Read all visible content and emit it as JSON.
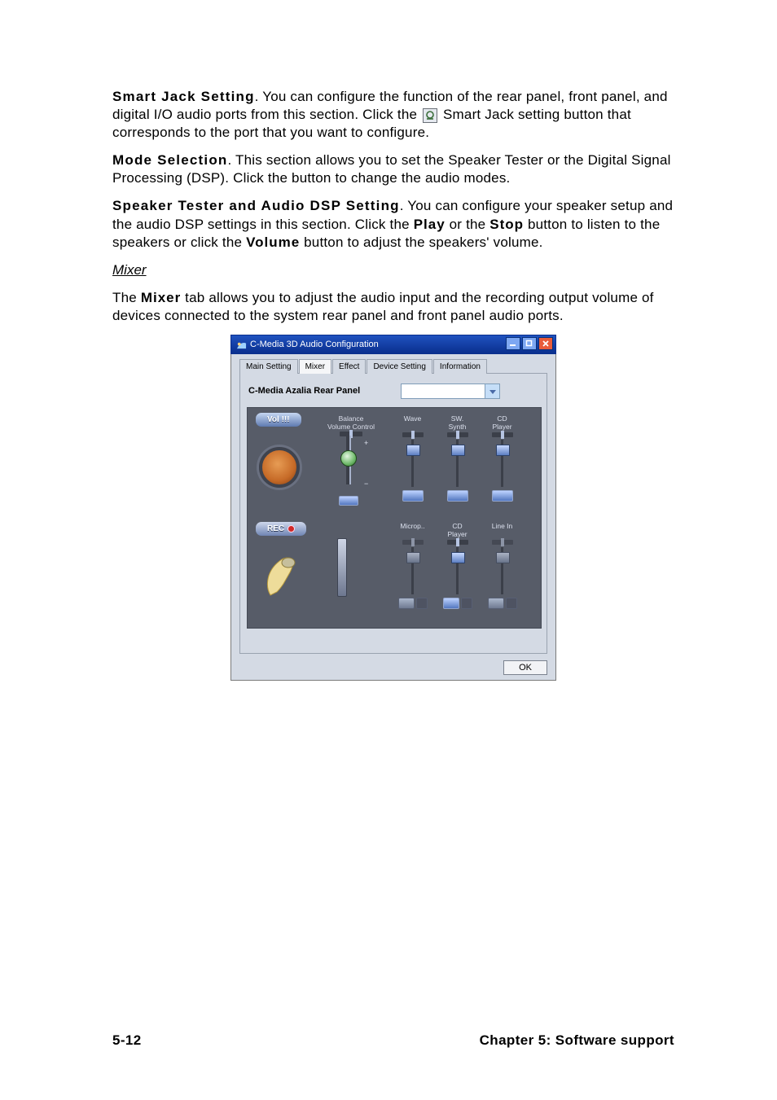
{
  "paragraphs": {
    "p1_bold": "Smart Jack Setting",
    "p1_rest_a": ". You can configure the function of the rear panel, front panel, and digital I/O audio ports from this section. Click the ",
    "p1_rest_b": " Smart Jack setting button that corresponds to the port that you want to configure.",
    "p2_bold": "Mode Selection",
    "p2_rest": ". This section allows you to set the Speaker Tester or the Digital Signal Processing (DSP). Click the button to change the audio modes.",
    "p3_bold": "Speaker Tester and Audio DSP Setting",
    "p3_rest_a": ". You can configure your speaker setup and the audio DSP settings in this section. Click the ",
    "p3_play": "Play",
    "p3_rest_b": " or the ",
    "p3_stop": "Stop",
    "p3_rest_c": " button to listen to the speakers or click the ",
    "p3_volume": "Volume",
    "p3_rest_d": " button to adjust the speakers' volume."
  },
  "sub_heading": "Mixer",
  "mixer_para_a": "The ",
  "mixer_para_bold": "Mixer",
  "mixer_para_b": " tab allows you to adjust the audio input and the recording output volume of devices connected to the system rear panel and front panel audio ports.",
  "window": {
    "title": "C-Media 3D Audio Configuration",
    "tabs": [
      "Main Setting",
      "Mixer",
      "Effect",
      "Device Setting",
      "Information"
    ],
    "active_tab_index": 1,
    "panel_label": "C-Media Azalia Rear Panel",
    "dropdown_value": "",
    "section_vol": "Vol !!!",
    "balance_label": "Balance\nVolume Control",
    "section_rec": "REC",
    "play_channels": [
      {
        "name": "Wave"
      },
      {
        "name": "SW.\nSynth"
      },
      {
        "name": "CD\nPlayer"
      }
    ],
    "rec_channels": [
      {
        "name": "Microp..",
        "disabled": false
      },
      {
        "name": "CD\nPlayer",
        "disabled": false
      },
      {
        "name": "Line In",
        "disabled": true
      }
    ],
    "ok_label": "OK"
  },
  "footer": {
    "left": "5-12",
    "right": "Chapter 5: Software support"
  },
  "colors": {
    "xp_blue": "#0a2f8e",
    "close_red": "#e85b3a"
  }
}
